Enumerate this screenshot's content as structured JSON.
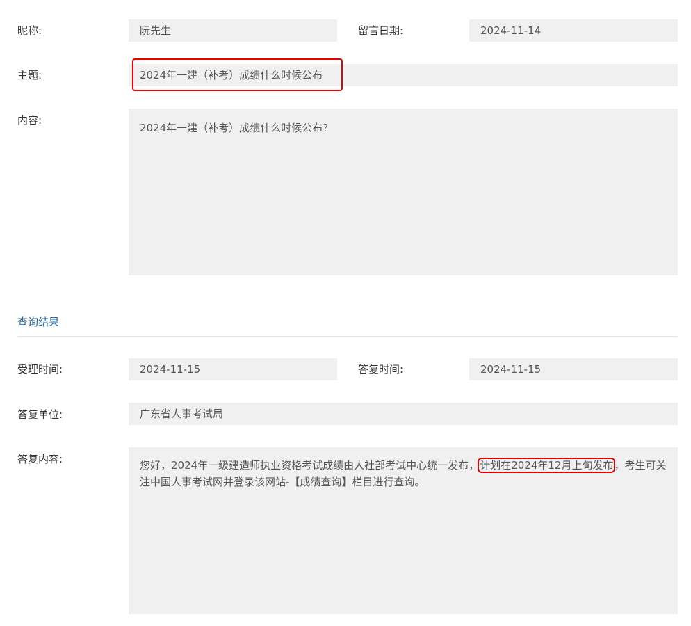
{
  "message": {
    "nickname_label": "昵称:",
    "nickname": "阮先生",
    "date_label": "留言日期:",
    "date": "2024-11-14",
    "subject_label": "主题:",
    "subject": "2024年一建（补考）成绩什么时候公布",
    "content_label": "内容:",
    "content": "2024年一建（补考）成绩什么时候公布?"
  },
  "result": {
    "section_title": "查询结果",
    "accept_time_label": "受理时间:",
    "accept_time": "2024-11-15",
    "reply_time_label": "答复时间:",
    "reply_time": "2024-11-15",
    "reply_unit_label": "答复单位:",
    "reply_unit": "广东省人事考试局",
    "reply_content_label": "答复内容:",
    "reply_content_part1": "您好，2024年一级建造师执业资格考试成绩由人社部考试中心统一发布，",
    "reply_content_highlight": "计划在2024年12月上旬发布",
    "reply_content_part2": "，考生可关注中国人事考试网并登录该网站-【成绩查询】栏目进行查询。"
  },
  "colors": {
    "highlight": "#e60000",
    "field_bg": "#f0f0f0",
    "section_title": "#2a6496"
  }
}
